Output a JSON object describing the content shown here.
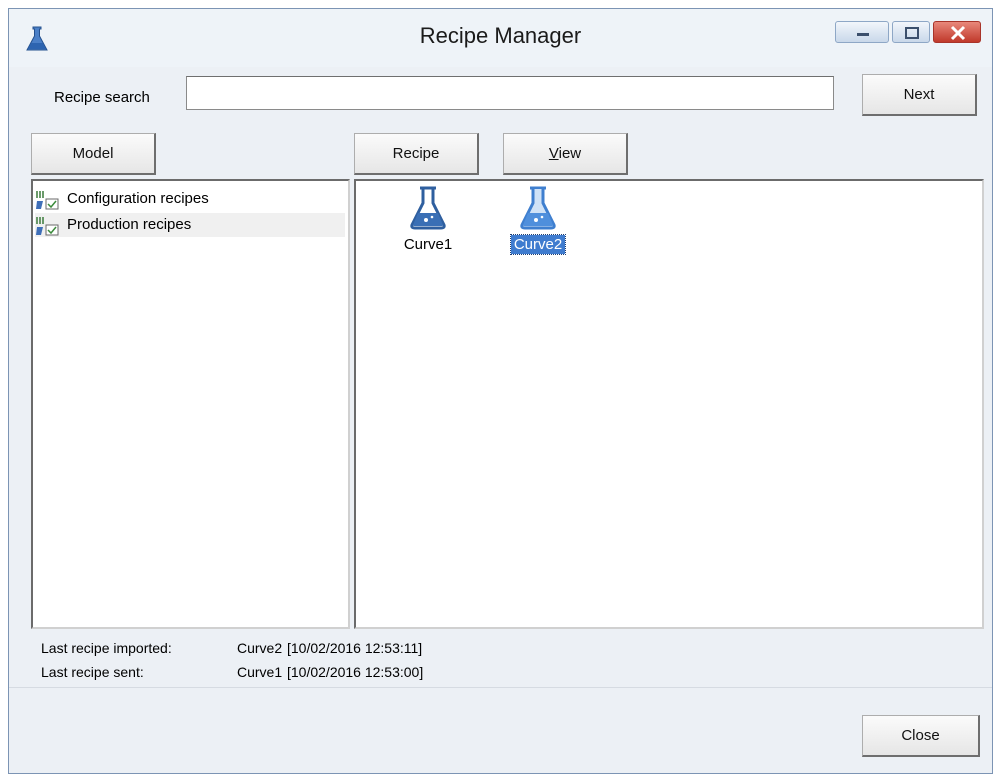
{
  "window": {
    "title": "Recipe Manager",
    "accent_color": "#3f7ccf",
    "close_color": "#c0392b"
  },
  "search": {
    "label": "Recipe search",
    "value": "",
    "placeholder": "",
    "next_label": "Next"
  },
  "toolbar": {
    "model_label": "Model",
    "recipe_label": "Recipe",
    "view_label": "View",
    "view_mnemonic": "V",
    "view_rest": "iew"
  },
  "tree": {
    "items": [
      {
        "label": "Configuration recipes",
        "icon": "recipe-list-icon",
        "selected": false
      },
      {
        "label": "Production recipes",
        "icon": "recipe-list-icon",
        "selected": true
      }
    ]
  },
  "recipes": {
    "items": [
      {
        "label": "Curve1",
        "icon": "flask-icon",
        "selected": false
      },
      {
        "label": "Curve2",
        "icon": "flask-icon",
        "selected": true
      }
    ]
  },
  "status": {
    "last_imported_label": "Last recipe imported:",
    "last_imported_name": "Curve2",
    "last_imported_time": "[10/02/2016 12:53:11]",
    "last_sent_label": "Last recipe sent:",
    "last_sent_name": "Curve1",
    "last_sent_time": "[10/02/2016 12:53:00]"
  },
  "footer": {
    "close_label": "Close"
  }
}
